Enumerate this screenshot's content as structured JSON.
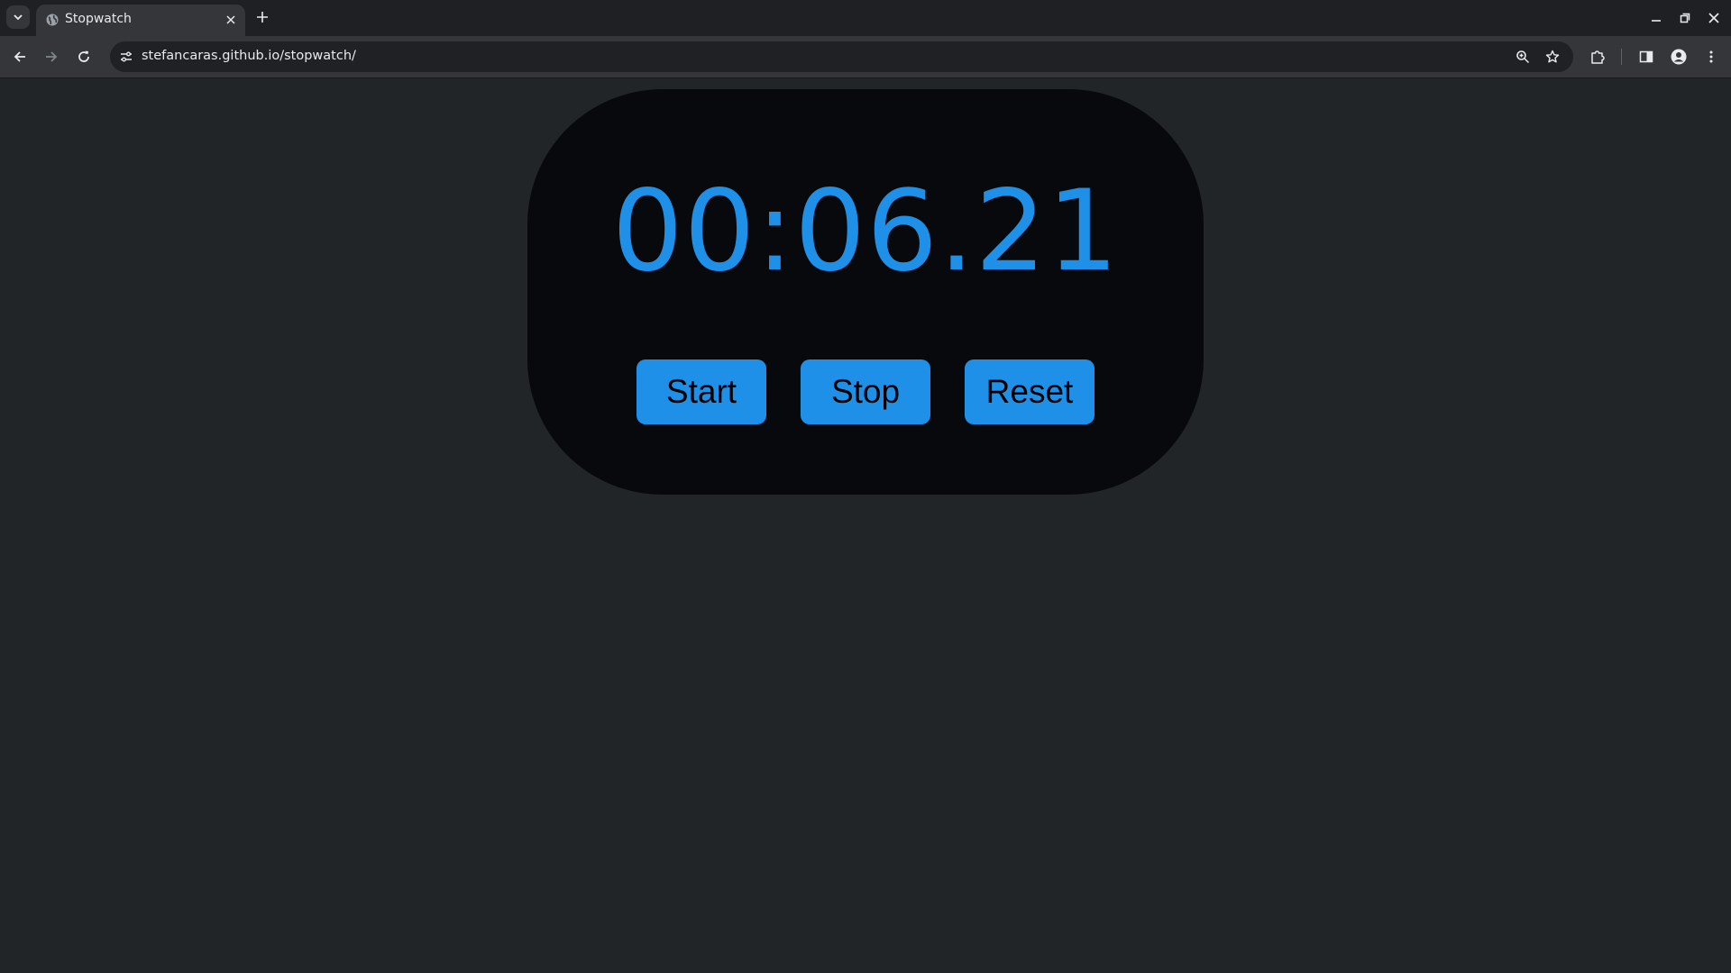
{
  "browser": {
    "tab": {
      "title": "Stopwatch",
      "favicon": "globe-icon"
    },
    "address_bar": {
      "url": "stefancaras.github.io/stopwatch/"
    },
    "icons": {
      "tab_search": "chevron-down-icon",
      "tab_close": "close-icon",
      "new_tab": "plus-icon",
      "minimize": "minimize-icon",
      "restore": "restore-icon",
      "close_window": "close-icon",
      "back": "back-arrow-icon",
      "forward": "forward-arrow-icon",
      "reload": "reload-icon",
      "site_info": "tune-icon",
      "zoom": "zoom-icon",
      "bookmark": "star-icon",
      "extensions": "puzzle-icon",
      "side_panel": "side-panel-icon",
      "profile": "profile-icon",
      "menu": "kebab-menu-icon"
    }
  },
  "stopwatch": {
    "time": "00:06.21",
    "buttons": {
      "start": "Start",
      "stop": "Stop",
      "reset": "Reset"
    }
  },
  "colors": {
    "accent": "#1e90e8",
    "page_background": "#222528",
    "panel_background": "#07090c",
    "button_text": "#000000"
  }
}
